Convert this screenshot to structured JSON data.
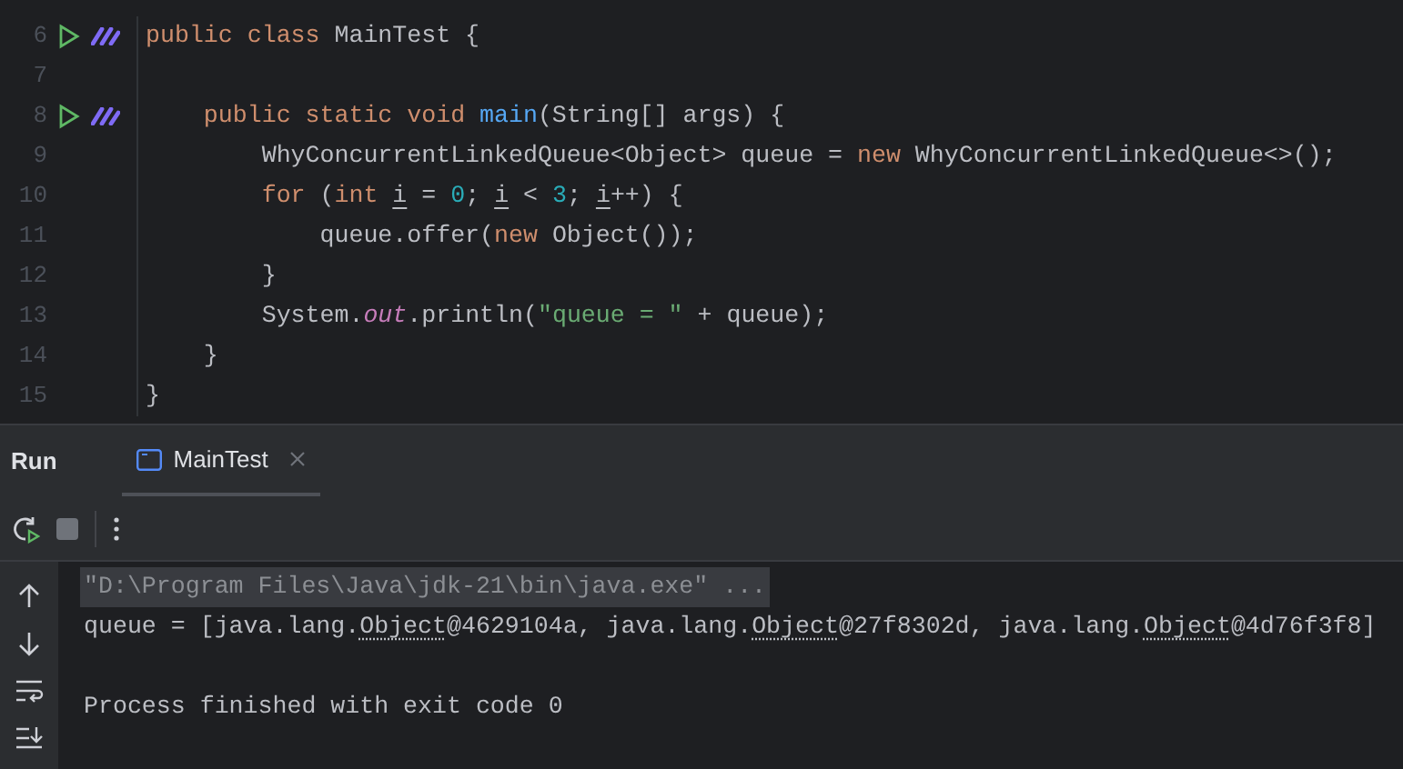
{
  "editor": {
    "lines": [
      {
        "number": "6",
        "runnable": true,
        "tokens": [
          {
            "kind": "keyword",
            "text": "public class "
          },
          {
            "kind": "plain",
            "text": "MainTest {"
          }
        ]
      },
      {
        "number": "7",
        "runnable": false
      },
      {
        "number": "8",
        "runnable": true,
        "tokens": [
          {
            "kind": "keyword",
            "text": "    public static void "
          },
          {
            "kind": "method",
            "text": "main"
          },
          {
            "kind": "plain",
            "text": "(String[] args) {"
          }
        ]
      },
      {
        "number": "9",
        "runnable": false,
        "tokens": [
          {
            "kind": "plain",
            "text": "        WhyConcurrentLinkedQueue<Object> queue = "
          },
          {
            "kind": "keyword",
            "text": "new "
          },
          {
            "kind": "plain",
            "text": "WhyConcurrentLinkedQueue<>();"
          }
        ]
      },
      {
        "number": "10",
        "runnable": false,
        "tokens": [
          {
            "kind": "keyword",
            "text": "        for "
          },
          {
            "kind": "plain",
            "text": "("
          },
          {
            "kind": "keyword",
            "text": "int "
          },
          {
            "kind": "variable",
            "text": "i"
          },
          {
            "kind": "plain",
            "text": " = "
          },
          {
            "kind": "number",
            "text": "0"
          },
          {
            "kind": "plain",
            "text": "; "
          },
          {
            "kind": "variable",
            "text": "i"
          },
          {
            "kind": "plain",
            "text": " < "
          },
          {
            "kind": "number",
            "text": "3"
          },
          {
            "kind": "plain",
            "text": "; "
          },
          {
            "kind": "variable",
            "text": "i"
          },
          {
            "kind": "plain",
            "text": "++) {"
          }
        ]
      },
      {
        "number": "11",
        "runnable": false,
        "tokens": [
          {
            "kind": "plain",
            "text": "            queue.offer("
          },
          {
            "kind": "keyword",
            "text": "new "
          },
          {
            "kind": "plain",
            "text": "Object());"
          }
        ]
      },
      {
        "number": "12",
        "runnable": false,
        "tokens": [
          {
            "kind": "plain",
            "text": "        }"
          }
        ]
      },
      {
        "number": "13",
        "runnable": false,
        "tokens": [
          {
            "kind": "plain",
            "text": "        System."
          },
          {
            "kind": "static",
            "text": "out"
          },
          {
            "kind": "plain",
            "text": ".println("
          },
          {
            "kind": "string",
            "text": "\"queue = \""
          },
          {
            "kind": "plain",
            "text": " + queue);"
          }
        ]
      },
      {
        "number": "14",
        "runnable": false,
        "tokens": [
          {
            "kind": "plain",
            "text": "    }"
          }
        ]
      },
      {
        "number": "15",
        "runnable": false,
        "tokens": [
          {
            "kind": "plain",
            "text": "}"
          }
        ]
      }
    ]
  },
  "run_panel": {
    "title": "Run",
    "tabs": [
      {
        "label": "MainTest",
        "selected": true
      }
    ],
    "output": [
      {
        "kind": "command",
        "text": "\"D:\\Program Files\\Java\\jdk-21\\bin\\java.exe\" ..."
      },
      {
        "kind": "result",
        "parts": [
          {
            "link": false,
            "text": "queue = [java.lang."
          },
          {
            "link": true,
            "text": "Object"
          },
          {
            "link": false,
            "text": "@4629104a, java.lang."
          },
          {
            "link": true,
            "text": "Object"
          },
          {
            "link": false,
            "text": "@27f8302d, java.lang."
          },
          {
            "link": true,
            "text": "Object"
          },
          {
            "link": false,
            "text": "@4d76f3f8]"
          }
        ]
      },
      {
        "kind": "blank"
      },
      {
        "kind": "result",
        "parts": [
          {
            "link": false,
            "text": "Process finished with exit code 0"
          }
        ]
      }
    ]
  }
}
